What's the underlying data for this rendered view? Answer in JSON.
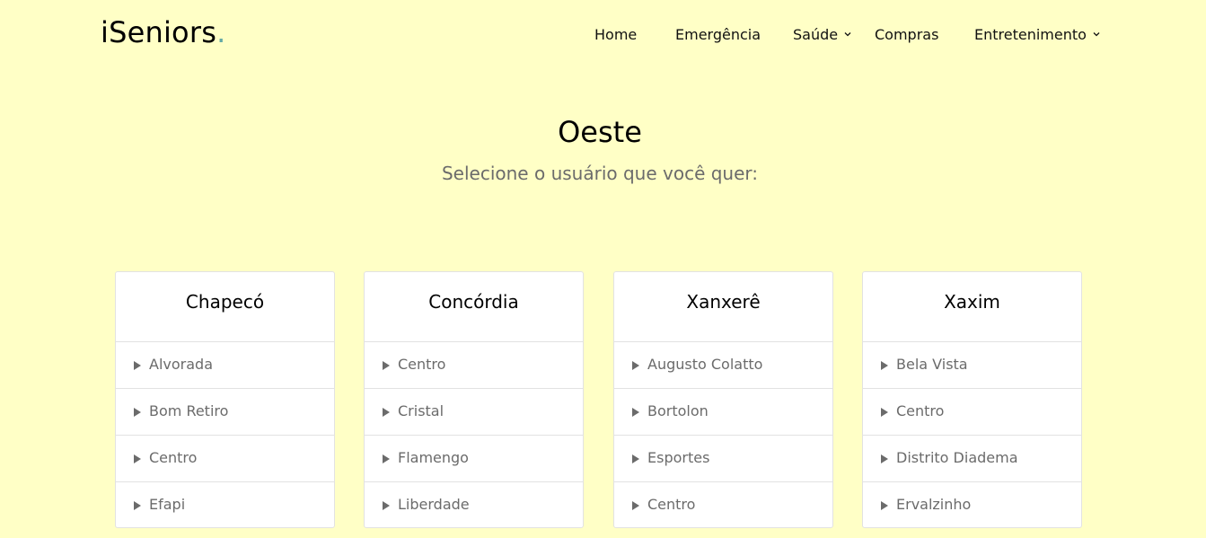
{
  "brand": {
    "name": "iSeniors",
    "dot": "."
  },
  "nav": {
    "home": "Home",
    "emergencia": "Emergência",
    "saude": "Saúde",
    "compras": "Compras",
    "entretenimento": "Entretenimento"
  },
  "page": {
    "title": "Oeste",
    "subtitle": "Selecione o usuário que você quer:"
  },
  "cities": [
    {
      "name": "Chapecó",
      "neighborhoods": [
        "Alvorada",
        "Bom Retiro",
        "Centro",
        "Efapi"
      ]
    },
    {
      "name": "Concórdia",
      "neighborhoods": [
        "Centro",
        "Cristal",
        "Flamengo",
        "Liberdade"
      ]
    },
    {
      "name": "Xanxerê",
      "neighborhoods": [
        "Augusto Colatto",
        "Bortolon",
        "Esportes",
        "Centro"
      ]
    },
    {
      "name": "Xaxim",
      "neighborhoods": [
        "Bela Vista",
        "Centro",
        "Distrito Diadema",
        "Ervalzinho"
      ]
    }
  ],
  "colors": {
    "background": "#ffffc6",
    "logo_dot": "#63a9a5",
    "muted_text": "#6b6b6b"
  }
}
